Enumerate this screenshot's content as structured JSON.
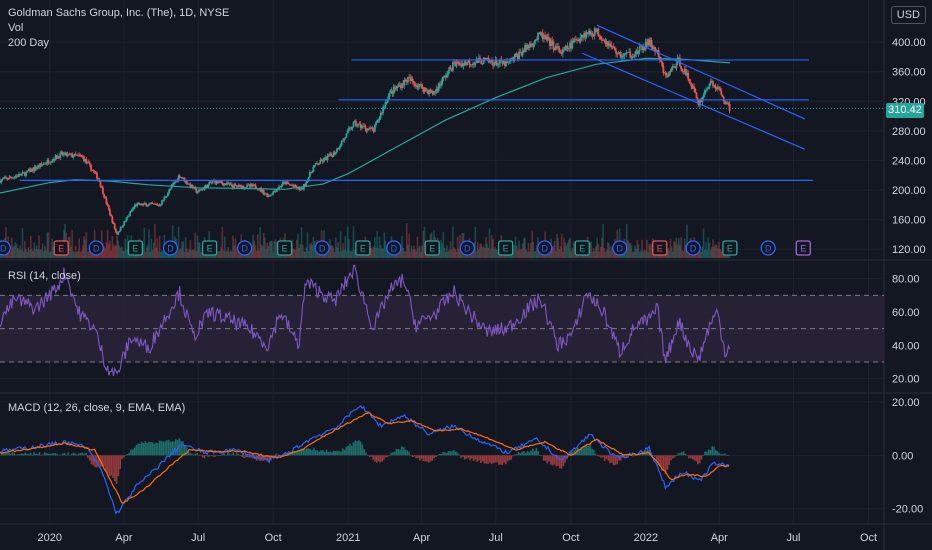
{
  "header": {
    "symbol_title": "Goldman Sachs Group, Inc. (The), 1D, NYSE",
    "vol_label": "Vol",
    "ma_label": "200 Day",
    "currency": "USD",
    "last_price": "310.42"
  },
  "rsi_panel": {
    "title": "RSI (14, close)"
  },
  "macd_panel": {
    "title": "MACD (12, 26, close, 9, EMA, EMA)"
  },
  "colors": {
    "background": "#131722",
    "up": "#26a69a",
    "down": "#ef5350",
    "ma": "#26a69a",
    "trendline": "#2962ff",
    "rsi": "#7e57c2",
    "rsi_band": "#2a2238",
    "macd": "#2962ff",
    "signal": "#ff6d00",
    "grid": "#1e222d",
    "text": "#d1d4dc"
  },
  "chart_data": [
    {
      "type": "candlestick",
      "title": "Goldman Sachs Group, Inc. (The), 1D, NYSE",
      "yticks": [
        120,
        160,
        200,
        240,
        280,
        320,
        360,
        400
      ],
      "ylim": [
        108,
        430
      ],
      "xlim": [
        "2019-11-01",
        "2022-10-20"
      ],
      "xticks": [
        {
          "date": "2020-01-01",
          "label": "2020"
        },
        {
          "date": "2020-04-01",
          "label": "Apr"
        },
        {
          "date": "2020-07-01",
          "label": "Jul"
        },
        {
          "date": "2020-10-01",
          "label": "Oct"
        },
        {
          "date": "2021-01-01",
          "label": "2021"
        },
        {
          "date": "2021-04-01",
          "label": "Apr"
        },
        {
          "date": "2021-07-01",
          "label": "Jul"
        },
        {
          "date": "2021-10-01",
          "label": "Oct"
        },
        {
          "date": "2022-01-01",
          "label": "2022"
        },
        {
          "date": "2022-04-01",
          "label": "Apr"
        },
        {
          "date": "2022-07-01",
          "label": "Jul"
        },
        {
          "date": "2022-10-01",
          "label": "Oct"
        }
      ],
      "close_path": [
        [
          "2019-11-01",
          213
        ],
        [
          "2019-12-01",
          222
        ],
        [
          "2020-01-15",
          248
        ],
        [
          "2020-02-10",
          245
        ],
        [
          "2020-03-01",
          215
        ],
        [
          "2020-03-23",
          140
        ],
        [
          "2020-04-15",
          180
        ],
        [
          "2020-05-15",
          180
        ],
        [
          "2020-06-08",
          220
        ],
        [
          "2020-06-30",
          197
        ],
        [
          "2020-07-20",
          212
        ],
        [
          "2020-08-15",
          205
        ],
        [
          "2020-09-10",
          205
        ],
        [
          "2020-09-25",
          192
        ],
        [
          "2020-10-15",
          210
        ],
        [
          "2020-11-05",
          200
        ],
        [
          "2020-11-20",
          232
        ],
        [
          "2020-12-15",
          250
        ],
        [
          "2021-01-08",
          290
        ],
        [
          "2021-02-01",
          280
        ],
        [
          "2021-02-20",
          330
        ],
        [
          "2021-03-15",
          350
        ],
        [
          "2021-04-15",
          330
        ],
        [
          "2021-05-10",
          370
        ],
        [
          "2021-06-15",
          375
        ],
        [
          "2021-07-15",
          370
        ],
        [
          "2021-08-10",
          395
        ],
        [
          "2021-08-25",
          410
        ],
        [
          "2021-09-20",
          385
        ],
        [
          "2021-10-15",
          410
        ],
        [
          "2021-11-01",
          415
        ],
        [
          "2021-11-30",
          382
        ],
        [
          "2021-12-20",
          385
        ],
        [
          "2022-01-05",
          400
        ],
        [
          "2022-01-15",
          385
        ],
        [
          "2022-01-25",
          352
        ],
        [
          "2022-02-10",
          375
        ],
        [
          "2022-02-25",
          345
        ],
        [
          "2022-03-07",
          317
        ],
        [
          "2022-03-20",
          345
        ],
        [
          "2022-03-30",
          338
        ],
        [
          "2022-04-08",
          320
        ],
        [
          "2022-04-14",
          310
        ]
      ],
      "moving_average_200": [
        [
          "2019-11-01",
          196
        ],
        [
          "2020-01-01",
          210
        ],
        [
          "2020-02-01",
          214
        ],
        [
          "2020-03-15",
          212
        ],
        [
          "2020-05-01",
          207
        ],
        [
          "2020-07-01",
          203
        ],
        [
          "2020-09-01",
          202
        ],
        [
          "2020-10-15",
          201
        ],
        [
          "2020-12-01",
          208
        ],
        [
          "2021-01-01",
          222
        ],
        [
          "2021-03-01",
          258
        ],
        [
          "2021-05-01",
          295
        ],
        [
          "2021-07-01",
          325
        ],
        [
          "2021-09-01",
          352
        ],
        [
          "2021-11-01",
          370
        ],
        [
          "2022-01-01",
          378
        ],
        [
          "2022-02-15",
          377
        ],
        [
          "2022-04-14",
          372
        ]
      ],
      "horizontal_levels": [
        {
          "price": 376,
          "from": "2021-01-05",
          "to": "2022-07-20"
        },
        {
          "price": 322,
          "from": "2020-12-20",
          "to": "2022-07-20"
        },
        {
          "price": 213,
          "from": "2019-11-25",
          "to": "2022-07-25"
        }
      ],
      "trend_channel": [
        {
          "from": [
            "2021-11-02",
            423
          ],
          "to": [
            "2022-07-15",
            296
          ]
        },
        {
          "from": [
            "2021-10-15",
            385
          ],
          "to": [
            "2022-07-15",
            255
          ]
        }
      ],
      "last_price": 310.42
    },
    {
      "type": "bar",
      "name": "Vol",
      "note": "volume histogram, no axis values printed"
    },
    {
      "type": "line",
      "title": "RSI (14, close)",
      "yticks": [
        20,
        40,
        60,
        80
      ],
      "ylim": [
        12,
        90
      ],
      "bands": {
        "upper": 70,
        "middle": 50,
        "lower": 30
      },
      "path": [
        [
          "2019-11-01",
          55
        ],
        [
          "2019-11-20",
          68
        ],
        [
          "2019-12-15",
          62
        ],
        [
          "2020-01-10",
          75
        ],
        [
          "2020-01-20",
          84
        ],
        [
          "2020-02-05",
          60
        ],
        [
          "2020-02-25",
          50
        ],
        [
          "2020-03-10",
          28
        ],
        [
          "2020-03-23",
          22
        ],
        [
          "2020-04-10",
          45
        ],
        [
          "2020-05-01",
          38
        ],
        [
          "2020-05-20",
          55
        ],
        [
          "2020-06-08",
          72
        ],
        [
          "2020-06-25",
          45
        ],
        [
          "2020-07-15",
          60
        ],
        [
          "2020-08-10",
          55
        ],
        [
          "2020-09-01",
          50
        ],
        [
          "2020-09-25",
          40
        ],
        [
          "2020-10-10",
          60
        ],
        [
          "2020-11-01",
          40
        ],
        [
          "2020-11-10",
          78
        ],
        [
          "2020-12-15",
          66
        ],
        [
          "2021-01-08",
          86
        ],
        [
          "2021-02-01",
          50
        ],
        [
          "2021-02-20",
          72
        ],
        [
          "2021-03-10",
          80
        ],
        [
          "2021-03-25",
          52
        ],
        [
          "2021-04-20",
          60
        ],
        [
          "2021-05-10",
          72
        ],
        [
          "2021-06-01",
          58
        ],
        [
          "2021-06-20",
          48
        ],
        [
          "2021-07-15",
          50
        ],
        [
          "2021-08-10",
          62
        ],
        [
          "2021-08-25",
          68
        ],
        [
          "2021-09-15",
          40
        ],
        [
          "2021-10-05",
          48
        ],
        [
          "2021-10-20",
          72
        ],
        [
          "2021-11-10",
          60
        ],
        [
          "2021-11-30",
          36
        ],
        [
          "2021-12-20",
          52
        ],
        [
          "2022-01-05",
          55
        ],
        [
          "2022-01-15",
          62
        ],
        [
          "2022-01-25",
          30
        ],
        [
          "2022-02-10",
          55
        ],
        [
          "2022-02-25",
          38
        ],
        [
          "2022-03-07",
          32
        ],
        [
          "2022-03-20",
          52
        ],
        [
          "2022-03-30",
          60
        ],
        [
          "2022-04-08",
          36
        ],
        [
          "2022-04-14",
          40
        ]
      ]
    },
    {
      "type": "line",
      "title": "MACD (12, 26, close, 9, EMA, EMA)",
      "yticks": [
        -20,
        0,
        20
      ],
      "ylim": [
        -25,
        23
      ],
      "series": [
        {
          "name": "MACD",
          "values": [
            [
              "2019-11-01",
              1.5
            ],
            [
              "2019-12-10",
              3
            ],
            [
              "2020-01-20",
              5
            ],
            [
              "2020-02-15",
              3
            ],
            [
              "2020-03-05",
              -6
            ],
            [
              "2020-03-23",
              -22
            ],
            [
              "2020-04-15",
              -12
            ],
            [
              "2020-05-10",
              -5
            ],
            [
              "2020-06-10",
              4
            ],
            [
              "2020-07-10",
              1
            ],
            [
              "2020-08-15",
              2
            ],
            [
              "2020-09-25",
              -2
            ],
            [
              "2020-10-20",
              1
            ],
            [
              "2020-11-15",
              6
            ],
            [
              "2020-12-20",
              11
            ],
            [
              "2021-01-15",
              19
            ],
            [
              "2021-02-10",
              11
            ],
            [
              "2021-03-10",
              15
            ],
            [
              "2021-04-10",
              8
            ],
            [
              "2021-05-10",
              11
            ],
            [
              "2021-06-15",
              5
            ],
            [
              "2021-07-15",
              1
            ],
            [
              "2021-08-20",
              6
            ],
            [
              "2021-09-20",
              -2
            ],
            [
              "2021-10-25",
              8
            ],
            [
              "2021-11-25",
              -1
            ],
            [
              "2021-12-25",
              1
            ],
            [
              "2022-01-05",
              3
            ],
            [
              "2022-01-25",
              -12
            ],
            [
              "2022-02-15",
              -6
            ],
            [
              "2022-03-07",
              -10
            ],
            [
              "2022-03-25",
              -3
            ],
            [
              "2022-04-14",
              -4
            ]
          ]
        },
        {
          "name": "Signal",
          "values": [
            [
              "2019-11-01",
              1
            ],
            [
              "2019-12-10",
              2.5
            ],
            [
              "2020-01-20",
              4.5
            ],
            [
              "2020-02-25",
              2
            ],
            [
              "2020-03-15",
              -9
            ],
            [
              "2020-03-30",
              -18
            ],
            [
              "2020-04-25",
              -13
            ],
            [
              "2020-05-20",
              -6
            ],
            [
              "2020-06-20",
              2
            ],
            [
              "2020-07-20",
              1.5
            ],
            [
              "2020-08-25",
              1.5
            ],
            [
              "2020-10-05",
              -1
            ],
            [
              "2020-11-05",
              2
            ],
            [
              "2020-12-01",
              7
            ],
            [
              "2021-01-25",
              16
            ],
            [
              "2021-02-20",
              12
            ],
            [
              "2021-03-20",
              13
            ],
            [
              "2021-04-20",
              9
            ],
            [
              "2021-05-20",
              10
            ],
            [
              "2021-06-25",
              6
            ],
            [
              "2021-07-25",
              2
            ],
            [
              "2021-08-30",
              5
            ],
            [
              "2021-10-01",
              0
            ],
            [
              "2021-11-01",
              6
            ],
            [
              "2021-12-05",
              0
            ],
            [
              "2022-01-05",
              1
            ],
            [
              "2022-02-01",
              -9
            ],
            [
              "2022-02-20",
              -7
            ],
            [
              "2022-03-15",
              -8
            ],
            [
              "2022-04-01",
              -4
            ],
            [
              "2022-04-14",
              -4
            ]
          ]
        }
      ]
    }
  ],
  "event_markers": [
    {
      "date": "2019-11-05",
      "letter": "D"
    },
    {
      "date": "2020-01-15",
      "letter": "E"
    },
    {
      "date": "2020-02-27",
      "letter": "D"
    },
    {
      "date": "2020-04-15",
      "letter": "E"
    },
    {
      "date": "2020-05-28",
      "letter": "D"
    },
    {
      "date": "2020-07-15",
      "letter": "E"
    },
    {
      "date": "2020-08-27",
      "letter": "D"
    },
    {
      "date": "2020-10-15",
      "letter": "E"
    },
    {
      "date": "2020-11-30",
      "letter": "D"
    },
    {
      "date": "2021-01-19",
      "letter": "E"
    },
    {
      "date": "2021-02-26",
      "letter": "D"
    },
    {
      "date": "2021-04-14",
      "letter": "E"
    },
    {
      "date": "2021-05-27",
      "letter": "D"
    },
    {
      "date": "2021-07-13",
      "letter": "E"
    },
    {
      "date": "2021-08-30",
      "letter": "D"
    },
    {
      "date": "2021-10-15",
      "letter": "E"
    },
    {
      "date": "2021-11-30",
      "letter": "D"
    },
    {
      "date": "2022-01-18",
      "letter": "E"
    },
    {
      "date": "2022-02-28",
      "letter": "D"
    },
    {
      "date": "2022-04-14",
      "letter": "E"
    },
    {
      "date": "2022-05-31",
      "letter": "D"
    },
    {
      "date": "2022-07-13",
      "letter": "E"
    }
  ]
}
